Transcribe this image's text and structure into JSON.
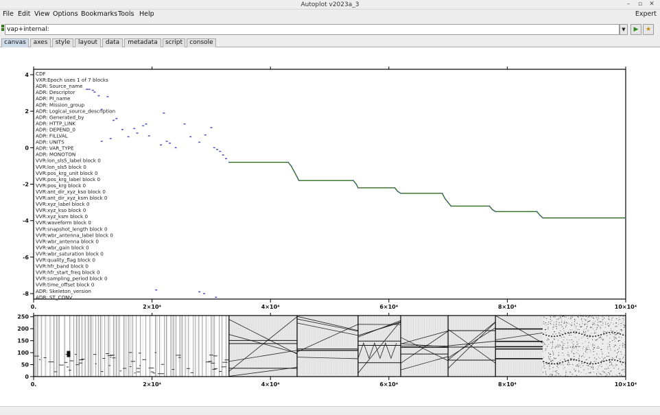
{
  "window": {
    "title": "Autoplot v2023a_3",
    "minimize_glyph": "–",
    "restore_glyph": "▫",
    "close_glyph": "✕"
  },
  "menu": {
    "items": [
      "File",
      "Edit",
      "View",
      "Options",
      "Bookmarks",
      "Tools",
      "Help"
    ],
    "expert_label": "Expert"
  },
  "address": {
    "value": "vap+internal:",
    "drop_glyph": "▼",
    "go_glyph": "▶",
    "bookmark_glyph": "★"
  },
  "tabs": [
    {
      "label": "canvas",
      "active": true
    },
    {
      "label": "axes",
      "active": false
    },
    {
      "label": "style",
      "active": false
    },
    {
      "label": "layout",
      "active": false
    },
    {
      "label": "data",
      "active": false
    },
    {
      "label": "metadata",
      "active": false
    },
    {
      "label": "script",
      "active": false
    },
    {
      "label": "console",
      "active": false
    }
  ],
  "chart_data": [
    {
      "type": "scatter",
      "title": "",
      "xlabel": "",
      "ylabel": "",
      "xlim": [
        0,
        100000
      ],
      "ylim": [
        -8.3,
        4.3
      ],
      "x_ticks": [
        0,
        20000,
        40000,
        60000,
        80000,
        100000
      ],
      "x_tick_labels": [
        "0.",
        "2×10⁴",
        "4×10⁴",
        "6×10⁴",
        "8×10⁴",
        "10×10⁴"
      ],
      "y_ticks": [
        4,
        2,
        0,
        -2,
        -4,
        -6,
        -8
      ],
      "y_tick_labels": [
        "4",
        "2",
        "0",
        "-2",
        "-4",
        "-6",
        "-8"
      ],
      "grid": false,
      "colors": {
        "points": "#5555cc",
        "steps": "#2a6a1c"
      },
      "annotations": [
        "CDF",
        "VXR:Epoch uses 1 of 7 blocks",
        "ADR: Source_name",
        "ADR: Descriptor",
        "ADR: PI_name",
        "ADR: Mission_group",
        "ADR: Logical_source_description",
        "ADR: Generated_by",
        "ADR: HTTP_LINK",
        "ADR: DEPEND_0",
        "ADR: FILLVAL",
        "ADR: UNITS",
        "ADR: VAR_TYPE",
        "ADR: MONOTON",
        "VVR:lon_sls5_label block 0",
        "VVR:lon_sls5 block 0",
        "VVR:pos_krg_unit block 0",
        "VVR:pos_krg_label block 0",
        "VVR:pos_krg block 0",
        "VVR:ant_dir_xyz_kso block 0",
        "VVR:ant_dir_xyz_ksm block 0",
        "VVR:xyz_label block 0",
        "VVR:xyz_kso block 0",
        "VVR:xyz_ksm block 0",
        "VVR:waveform block 0",
        "VVR:snapshot_length block 0",
        "VVR:wbr_antenna_label block 0",
        "VVR:wbr_antenna block 0",
        "VVR:wbr_gain block 0",
        "VVR:wbr_saturation block 0",
        "VVR:quality_flag block 0",
        "VVR:hfr_band block 0",
        "VVR:hfr_start_freq block 0",
        "VVR:sampling_period block 0",
        "VVR:time_offset block 0",
        "ADR: Skeleton_version",
        "ADR: ST_CONV"
      ],
      "points": [
        [
          9000,
          3.2
        ],
        [
          9400,
          3.2
        ],
        [
          10000,
          3.15
        ],
        [
          10300,
          3.05
        ],
        [
          11000,
          2.85
        ],
        [
          12500,
          2.8
        ],
        [
          11500,
          2.1
        ],
        [
          13500,
          1.5
        ],
        [
          14000,
          1.6
        ],
        [
          15000,
          1.0
        ],
        [
          17000,
          1.05
        ],
        [
          18500,
          1.2
        ],
        [
          19000,
          1.3
        ],
        [
          11500,
          0.35
        ],
        [
          13000,
          0.5
        ],
        [
          16000,
          0.6
        ],
        [
          17500,
          0.8
        ],
        [
          19500,
          0.65
        ],
        [
          21500,
          0.15
        ],
        [
          22000,
          1.9
        ],
        [
          22500,
          0.35
        ],
        [
          23000,
          0.25
        ],
        [
          24000,
          0.0
        ],
        [
          25500,
          1.3
        ],
        [
          26500,
          0.6
        ],
        [
          28000,
          0.3
        ],
        [
          29000,
          0.7
        ],
        [
          30000,
          1.1
        ],
        [
          30500,
          0.0
        ],
        [
          31000,
          -0.1
        ],
        [
          31500,
          -0.2
        ],
        [
          32000,
          -0.4
        ],
        [
          32500,
          -0.6
        ],
        [
          20700,
          -7.8
        ],
        [
          28000,
          -7.9
        ],
        [
          28800,
          -8.0
        ],
        [
          30800,
          -8.2
        ]
      ],
      "step_line": [
        [
          33000,
          -0.8
        ],
        [
          43000,
          -0.8
        ],
        [
          43500,
          -1.0
        ],
        [
          44000,
          -1.3
        ],
        [
          44500,
          -1.6
        ],
        [
          44800,
          -1.8
        ],
        [
          54000,
          -1.8
        ],
        [
          54500,
          -2.0
        ],
        [
          54800,
          -2.2
        ],
        [
          61000,
          -2.2
        ],
        [
          61500,
          -2.4
        ],
        [
          62000,
          -2.5
        ],
        [
          69000,
          -2.5
        ],
        [
          69500,
          -2.8
        ],
        [
          70000,
          -3.0
        ],
        [
          70500,
          -3.2
        ],
        [
          77000,
          -3.2
        ],
        [
          77500,
          -3.4
        ],
        [
          78000,
          -3.5
        ],
        [
          85000,
          -3.5
        ],
        [
          85500,
          -3.7
        ],
        [
          86000,
          -3.85
        ],
        [
          100000,
          -3.85
        ]
      ]
    },
    {
      "type": "heatmap",
      "title": "",
      "xlabel": "",
      "ylabel": "",
      "xlim": [
        0,
        100000
      ],
      "ylim": [
        0,
        255
      ],
      "x_ticks": [
        0,
        20000,
        40000,
        60000,
        80000,
        100000
      ],
      "x_tick_labels": [
        "0.",
        "2×10⁴",
        "4×10⁴",
        "6×10⁴",
        "8×10⁴",
        "10×10⁴"
      ],
      "y_ticks": [
        250,
        200,
        150,
        100,
        50,
        0
      ],
      "y_tick_labels": [
        "250",
        "200",
        "150",
        "100",
        "50",
        "0"
      ],
      "grid": false,
      "blocks": [
        {
          "x0": 0,
          "x1": 33000,
          "pattern": "sparse-bars"
        },
        {
          "x0": 33000,
          "x1": 44500,
          "pattern": "diagonals"
        },
        {
          "x0": 44500,
          "x1": 54800,
          "pattern": "crossing"
        },
        {
          "x0": 54800,
          "x1": 62000,
          "pattern": "zigzag"
        },
        {
          "x0": 62000,
          "x1": 70000,
          "pattern": "diagonals"
        },
        {
          "x0": 70000,
          "x1": 78000,
          "pattern": "diagonals"
        },
        {
          "x0": 78000,
          "x1": 86000,
          "pattern": "bands"
        },
        {
          "x0": 86000,
          "x1": 100000,
          "pattern": "noise"
        }
      ]
    }
  ]
}
